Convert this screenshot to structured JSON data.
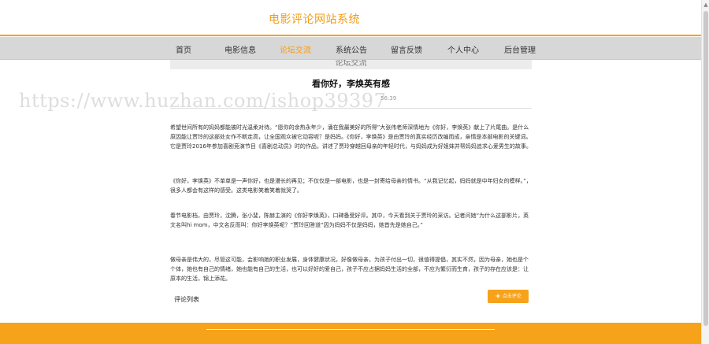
{
  "header": {
    "site_title": "电影评论网站系统"
  },
  "nav": {
    "items": [
      {
        "label": "首页"
      },
      {
        "label": "电影信息"
      },
      {
        "label": "论坛交流"
      },
      {
        "label": "系统公告"
      },
      {
        "label": "留言反馈"
      },
      {
        "label": "个人中心"
      },
      {
        "label": "后台管理"
      }
    ],
    "active_index": 2
  },
  "post": {
    "board_title": "论坛交流",
    "title": "看你好，李焕英有感",
    "meta_time": "56:39",
    "paragraphs": [
      "希望世间所有的妈妈都能被时光温柔对待。“愿你的余热永年少，涌在我最美好的所得”大张伟老师深情地为《你好，李焕英》献上了片尾曲。是什么原因能让贾玲的这部处女作不断走高，让全国观众被它动容呢？是妈妈。《你好，李焕英》是由贾玲的真实经历改编而成，亲情是本部电影的关键词。它是贾玲2016年参加喜剧竞演节目《喜剧总动员》时的作品，讲述了贾玲穿越回母亲的年轻时代，与妈妈成为好姐妹并帮妈妈追求心爱男生的故事。",
      "《你好，李焕英》不单单是一声你好，也是漫长的再见；不仅仅是一部电影，也是一封寄给母亲的情书。“从我记忆起，妈妈就是中年妇女的模样。”，很多人都会有这样的感受。这类电影笑着笑着就哭了。",
      "春节电影档，由贾玲，沈腾，张小斐，陈赫主演的《你好李焕英》，口碑备受好评。其中，今天看到关于贾玲的采访。记者问她“为什么这部影片，英文名叫hi mom，中文名反而叫：你好李焕英呢？”贾玲回答道“因为妈妈不仅是妈妈，她首先是她自己。”",
      "做母亲是伟大的，尽管这可能，会影响她的职业发展，身体健康状况，好像做母亲，为孩子付出一切，很值得提倡，其实不然，因为母亲，她也是个个体，她也有自己的情绪，她也能有自己的生活，也可以好好的爱自己，孩子不应占据妈妈生活的全部，不应为繁衍而生育，孩子的存在应该是：让原本的生活，锦上添花。"
    ]
  },
  "comments": {
    "list_label": "评论列表",
    "add_button_label": "点击评论",
    "add_button_icon": "plus-icon"
  },
  "watermark": {
    "text": "https://www.huzhan.com/ishop39397"
  },
  "colors": {
    "accent": "#f7a21b",
    "title_orange": "#f39c12",
    "nav_bg": "#d7d7d7"
  }
}
